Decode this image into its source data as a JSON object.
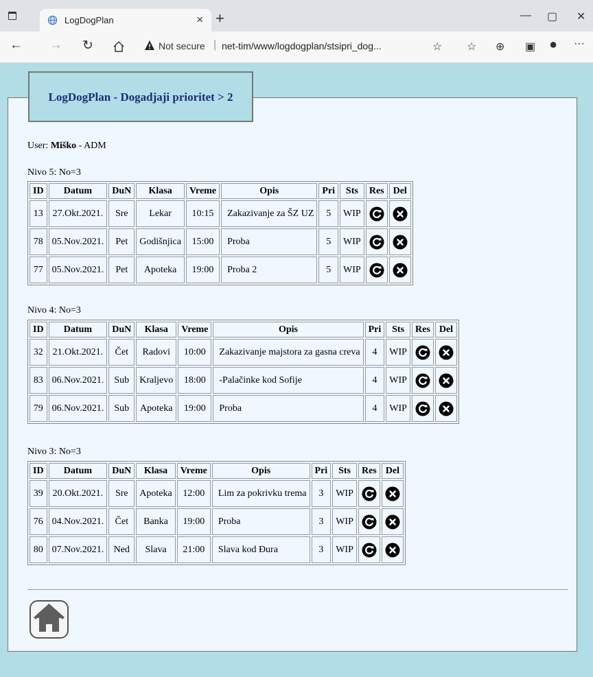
{
  "browser": {
    "tab_title": "LogDogPlan",
    "address_security": "Not secure",
    "address_url": "net-tim/www/logdogplan/stsipri_dog..."
  },
  "page": {
    "heading": "LogDogPlan - Dogadjaji prioritet > 2",
    "user_prefix": "User: ",
    "user_name": "Miško",
    "user_suffix": " - ADM"
  },
  "columns": [
    "ID",
    "Datum",
    "DuN",
    "Klasa",
    "Vreme",
    "Opis",
    "Pri",
    "Sts",
    "Res",
    "Del"
  ],
  "groups": [
    {
      "label": "Nivo 5: No=3",
      "rows": [
        {
          "id": "13",
          "datum": "27.Okt.2021.",
          "dun": "Sre",
          "klasa": "Lekar",
          "vreme": "10:15",
          "opis": "Zakazivanje za ŠZ UZ",
          "pri": "5",
          "sts": "WIP"
        },
        {
          "id": "78",
          "datum": "05.Nov.2021.",
          "dun": "Pet",
          "klasa": "Godišnjica",
          "vreme": "15:00",
          "opis": "Proba",
          "pri": "5",
          "sts": "WIP"
        },
        {
          "id": "77",
          "datum": "05.Nov.2021.",
          "dun": "Pet",
          "klasa": "Apoteka",
          "vreme": "19:00",
          "opis": "Proba 2",
          "pri": "5",
          "sts": "WIP"
        }
      ]
    },
    {
      "label": "Nivo 4: No=3",
      "rows": [
        {
          "id": "32",
          "datum": "21.Okt.2021.",
          "dun": "Čet",
          "klasa": "Radovi",
          "vreme": "10:00",
          "opis": "Zakazivanje majstora za gasna creva",
          "pri": "4",
          "sts": "WIP"
        },
        {
          "id": "83",
          "datum": "06.Nov.2021.",
          "dun": "Sub",
          "klasa": "Kraljevo",
          "vreme": "18:00",
          "opis": "-Palačinke kod Sofije",
          "pri": "4",
          "sts": "WIP"
        },
        {
          "id": "79",
          "datum": "06.Nov.2021.",
          "dun": "Sub",
          "klasa": "Apoteka",
          "vreme": "19:00",
          "opis": "Proba",
          "pri": "4",
          "sts": "WIP"
        }
      ]
    },
    {
      "label": "Nivo 3: No=3",
      "rows": [
        {
          "id": "39",
          "datum": "20.Okt.2021.",
          "dun": "Sre",
          "klasa": "Apoteka",
          "vreme": "12:00",
          "opis": "Lim za pokrivku trema",
          "pri": "3",
          "sts": "WIP"
        },
        {
          "id": "76",
          "datum": "04.Nov.2021.",
          "dun": "Čet",
          "klasa": "Banka",
          "vreme": "19:00",
          "opis": "Proba",
          "pri": "3",
          "sts": "WIP"
        },
        {
          "id": "80",
          "datum": "07.Nov.2021.",
          "dun": "Ned",
          "klasa": "Slava",
          "vreme": "21:00",
          "opis": "Slava kod Đura",
          "pri": "3",
          "sts": "WIP"
        }
      ]
    }
  ],
  "icons": {
    "reset": "refresh-icon",
    "delete": "delete-icon",
    "home": "home-icon"
  }
}
